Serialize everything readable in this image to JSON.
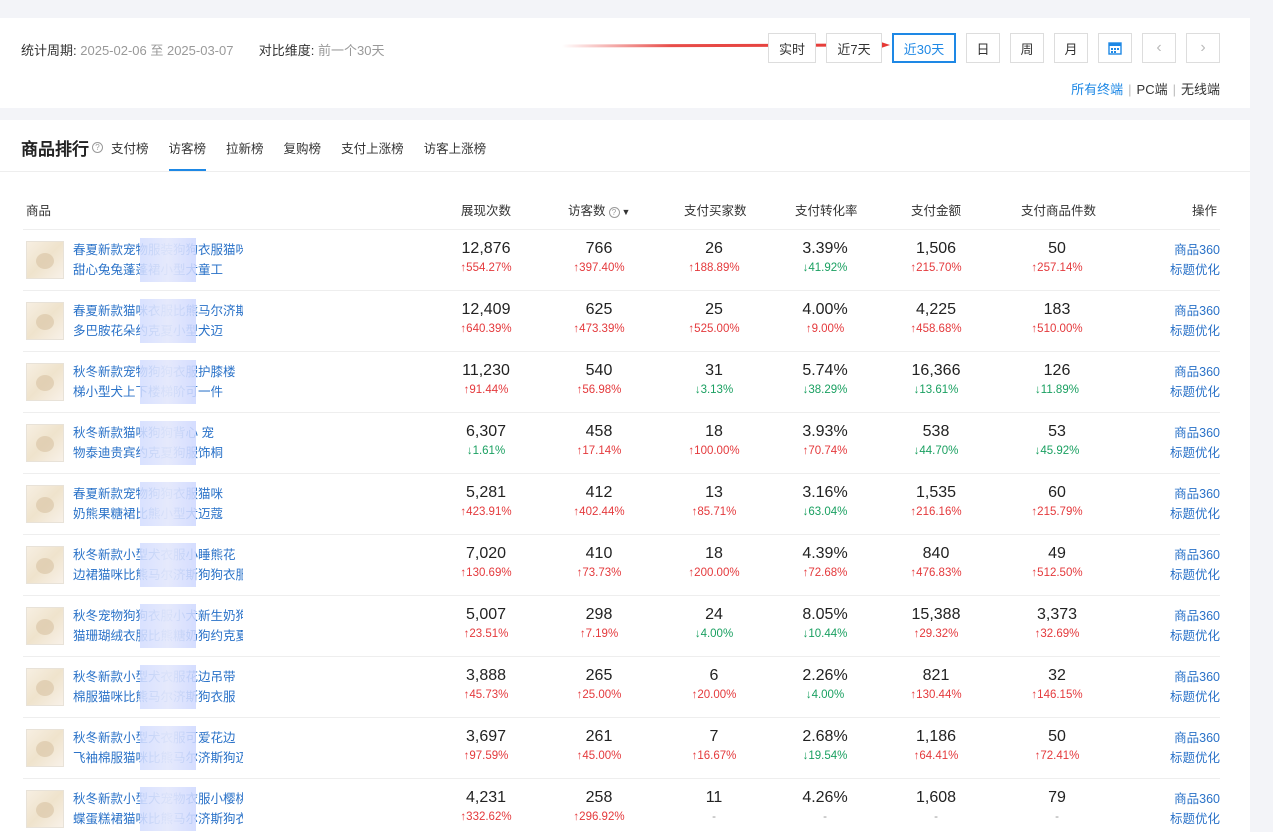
{
  "filter": {
    "period_label": "统计周期:",
    "period_value": "2025-02-06 至 2025-03-07",
    "compare_label": "对比维度:",
    "compare_value": "前一个30天"
  },
  "time_buttons": [
    "实时",
    "近7天",
    "近30天",
    "日",
    "周",
    "月"
  ],
  "time_icons": {
    "calendar": "calendar-icon",
    "prev": "chevron-left-icon",
    "next": "chevron-right-icon"
  },
  "terminals": {
    "all": "所有终端",
    "pc": "PC端",
    "wireless": "无线端"
  },
  "ranking": {
    "title": "商品排行",
    "tabs": [
      "支付榜",
      "访客榜",
      "拉新榜",
      "复购榜",
      "支付上涨榜",
      "访客上涨榜"
    ],
    "active_tab": "访客榜"
  },
  "table": {
    "headers": {
      "product": "商品",
      "impressions": "展现次数",
      "visitors": "访客数",
      "buyers": "支付买家数",
      "conversion": "支付转化率",
      "amount": "支付金额",
      "items": "支付商品件数",
      "ops": "操作"
    },
    "op_labels": [
      "商品360",
      "标题优化"
    ],
    "rows": [
      {
        "name1": "春夏新款宠物服装狗狗衣服猫咪",
        "name2": "甜心兔兔蓬蓬裙小型犬童工",
        "cells": [
          [
            "12,876",
            "554.27%",
            "up"
          ],
          [
            "766",
            "397.40%",
            "up"
          ],
          [
            "26",
            "188.89%",
            "up"
          ],
          [
            "3.39%",
            "41.92%",
            "down"
          ],
          [
            "1,506",
            "215.70%",
            "up"
          ],
          [
            "50",
            "257.14%",
            "up"
          ]
        ]
      },
      {
        "name1": "春夏新款猫咪衣服比熊马尔济斯服装",
        "name2": "多巴胺花朵约克夏小型犬迈",
        "cells": [
          [
            "12,409",
            "640.39%",
            "up"
          ],
          [
            "625",
            "473.39%",
            "up"
          ],
          [
            "25",
            "525.00%",
            "up"
          ],
          [
            "4.00%",
            "9.00%",
            "up"
          ],
          [
            "4,225",
            "458.68%",
            "up"
          ],
          [
            "183",
            "510.00%",
            "up"
          ]
        ]
      },
      {
        "name1": "秋冬新款宠物狗狗衣服护膝楼",
        "name2": "梯小型犬上下楼梯阶可一件",
        "cells": [
          [
            "11,230",
            "91.44%",
            "up"
          ],
          [
            "540",
            "56.98%",
            "up"
          ],
          [
            "31",
            "3.13%",
            "down"
          ],
          [
            "5.74%",
            "38.29%",
            "down"
          ],
          [
            "16,366",
            "13.61%",
            "down"
          ],
          [
            "126",
            "11.89%",
            "down"
          ]
        ]
      },
      {
        "name1": "秋冬新款猫咪狗狗背心 宠",
        "name2": "物泰迪贵宾约克夏狗服饰桐",
        "cells": [
          [
            "6,307",
            "1.61%",
            "down"
          ],
          [
            "458",
            "17.14%",
            "up"
          ],
          [
            "18",
            "100.00%",
            "up"
          ],
          [
            "3.93%",
            "70.74%",
            "up"
          ],
          [
            "538",
            "44.70%",
            "down"
          ],
          [
            "53",
            "45.92%",
            "down"
          ]
        ]
      },
      {
        "name1": "春夏新款宠物狗狗衣服猫咪",
        "name2": "奶熊果糖裙比熊小型犬迈蔻",
        "cells": [
          [
            "5,281",
            "423.91%",
            "up"
          ],
          [
            "412",
            "402.44%",
            "up"
          ],
          [
            "13",
            "85.71%",
            "up"
          ],
          [
            "3.16%",
            "63.04%",
            "down"
          ],
          [
            "1,535",
            "216.16%",
            "up"
          ],
          [
            "60",
            "215.79%",
            "up"
          ]
        ]
      },
      {
        "name1": "秋冬新款小型犬衣服小睡熊花",
        "name2": "边裙猫咪比熊马尔济斯狗狗衣服",
        "cells": [
          [
            "7,020",
            "130.69%",
            "up"
          ],
          [
            "410",
            "73.73%",
            "up"
          ],
          [
            "18",
            "200.00%",
            "up"
          ],
          [
            "4.39%",
            "72.68%",
            "up"
          ],
          [
            "840",
            "476.83%",
            "up"
          ],
          [
            "49",
            "512.50%",
            "up"
          ]
        ]
      },
      {
        "name1": "秋冬宠物狗狗衣服小犬新生奶狗奶",
        "name2": "猫珊瑚绒衣服比熊糖奶狗约克夏",
        "cells": [
          [
            "5,007",
            "23.51%",
            "up"
          ],
          [
            "298",
            "7.19%",
            "up"
          ],
          [
            "24",
            "4.00%",
            "down"
          ],
          [
            "8.05%",
            "10.44%",
            "down"
          ],
          [
            "15,388",
            "29.32%",
            "up"
          ],
          [
            "3,373",
            "32.69%",
            "up"
          ]
        ]
      },
      {
        "name1": "秋冬新款小型犬衣服花边吊带",
        "name2": "棉服猫咪比熊马尔济斯狗衣服",
        "cells": [
          [
            "3,888",
            "45.73%",
            "up"
          ],
          [
            "265",
            "25.00%",
            "up"
          ],
          [
            "6",
            "20.00%",
            "up"
          ],
          [
            "2.26%",
            "4.00%",
            "down"
          ],
          [
            "821",
            "130.44%",
            "up"
          ],
          [
            "32",
            "146.15%",
            "up"
          ]
        ]
      },
      {
        "name1": "秋冬新款小型犬衣服可爱花边",
        "name2": "飞袖棉服猫咪比熊马尔济斯狗迈",
        "cells": [
          [
            "3,697",
            "97.59%",
            "up"
          ],
          [
            "261",
            "45.00%",
            "up"
          ],
          [
            "7",
            "16.67%",
            "up"
          ],
          [
            "2.68%",
            "19.54%",
            "down"
          ],
          [
            "1,186",
            "64.41%",
            "up"
          ],
          [
            "50",
            "72.41%",
            "up"
          ]
        ]
      },
      {
        "name1": "秋冬新款小型犬宠物衣服小樱桃蝴",
        "name2": "蝶蛋糕裙猫咪比熊马尔济斯狗衣",
        "cells": [
          [
            "4,231",
            "332.62%",
            "up"
          ],
          [
            "258",
            "296.92%",
            "up"
          ],
          [
            "11",
            "-",
            "flat"
          ],
          [
            "4.26%",
            "-",
            "flat"
          ],
          [
            "1,608",
            "-",
            "flat"
          ],
          [
            "79",
            "-",
            "flat"
          ]
        ]
      }
    ]
  }
}
